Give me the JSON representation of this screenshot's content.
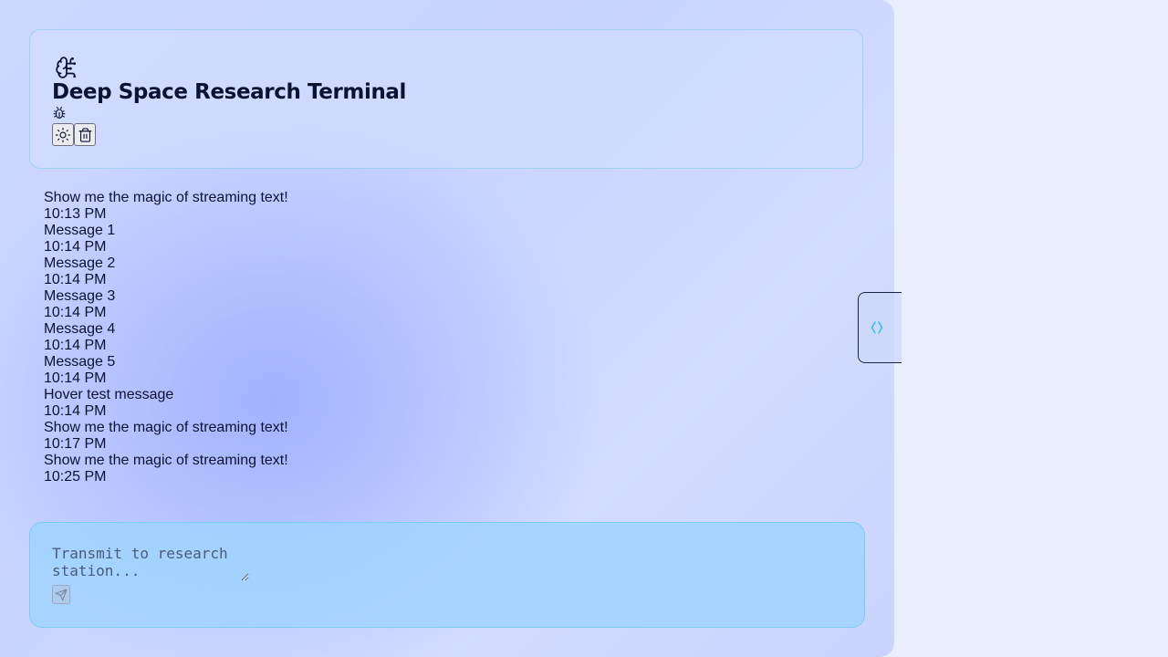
{
  "app": {
    "title": "Deep Space Research Terminal"
  },
  "icons": {
    "brand": "brain-circuit-icon",
    "debug": "bug-icon",
    "theme": "sun-icon",
    "clear": "trash-icon",
    "send": "send-icon",
    "side_tab": "code-icon"
  },
  "messages": [
    {
      "text": "Show me the magic of streaming text!",
      "time": "10:13 PM"
    },
    {
      "text": "Message 1",
      "time": "10:14 PM"
    },
    {
      "text": "Message 2",
      "time": "10:14 PM"
    },
    {
      "text": "Message 3",
      "time": "10:14 PM"
    },
    {
      "text": "Message 4",
      "time": "10:14 PM"
    },
    {
      "text": "Message 5",
      "time": "10:14 PM"
    },
    {
      "text": "Hover test message",
      "time": "10:14 PM"
    },
    {
      "text": "Show me the magic of streaming text!",
      "time": "10:17 PM"
    },
    {
      "text": "Show me the magic of streaming text!",
      "time": "10:25 PM"
    }
  ],
  "composer": {
    "placeholder": "Transmit to research station..."
  },
  "colors": {
    "text": "#0b1330",
    "accent": "#22c3e6",
    "border": "#9fd0f2"
  }
}
